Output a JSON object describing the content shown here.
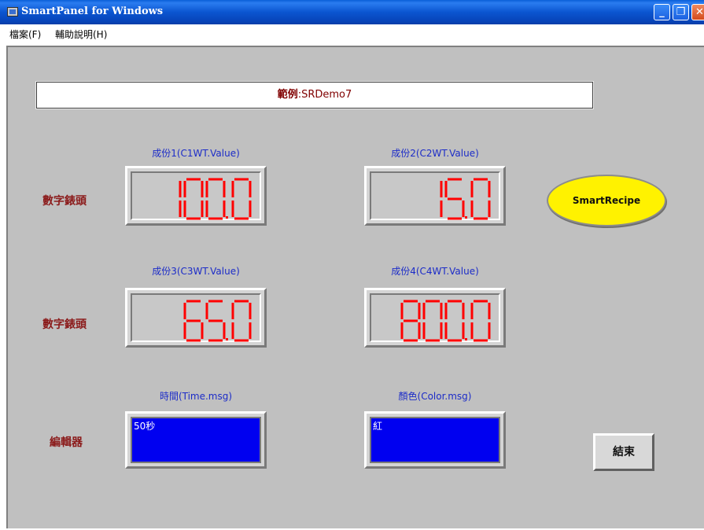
{
  "window": {
    "title": "SmartPanel for Windows",
    "minimize_glyph": "_",
    "maximize_glyph": "❐",
    "close_glyph": "✕"
  },
  "menu": {
    "items": [
      {
        "label": "檔案(F)"
      },
      {
        "label": "輔助說明(H)"
      }
    ]
  },
  "header": {
    "prefix": "範例",
    "name": ":SRDemo7"
  },
  "rows": {
    "row1_label": "數字錶頭",
    "row2_label": "數字錶頭",
    "row3_label": "編輯器"
  },
  "displays": [
    {
      "caption": "成份1(C1WT.Value)",
      "value": "100.0"
    },
    {
      "caption": "成份2(C2WT.Value)",
      "value": "15.0"
    },
    {
      "caption": "成份3(C3WT.Value)",
      "value": "65.0"
    },
    {
      "caption": "成份4(C4WT.Value)",
      "value": "800.0"
    }
  ],
  "editors": [
    {
      "caption": "時間(Time.msg)",
      "value": "50秒"
    },
    {
      "caption": "顏色(Color.msg)",
      "value": "紅"
    }
  ],
  "buttons": {
    "recipe": "SmartRecipe",
    "end": "結束"
  },
  "colors": {
    "led_segment": "#ff0000",
    "editor_bg": "#0000f0",
    "recipe_bg": "#fff200",
    "caption": "#1c2cc8",
    "row_label": "#8b1a1a"
  }
}
